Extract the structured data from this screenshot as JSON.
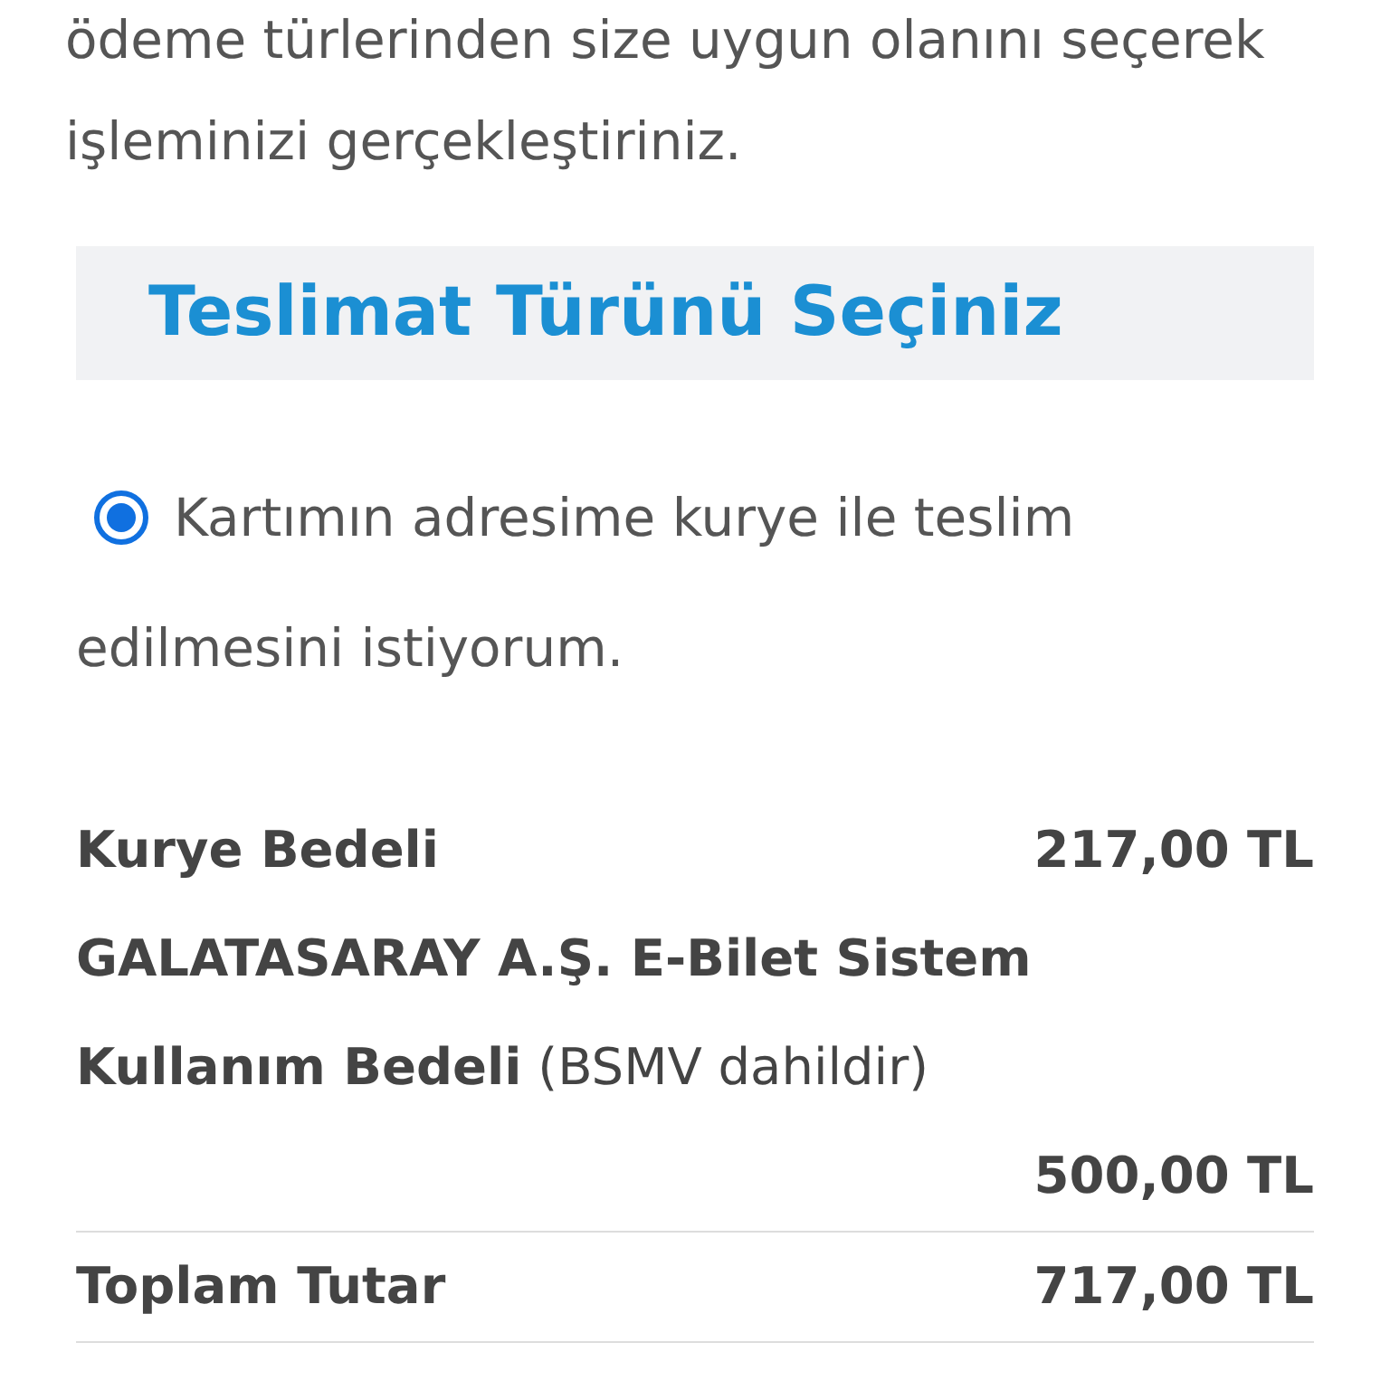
{
  "intro": "ödeme türlerinden size uygun olanını seçerek işleminizi gerçekleştiriniz.",
  "section_title": "Teslimat Türünü Seçiniz",
  "delivery_options": [
    {
      "label": "Kartımın adresime kurye ile teslim edilmesini istiyorum.",
      "selected": true
    }
  ],
  "fees": [
    {
      "label": "**Kurye Bedeli**",
      "amount": "217,00 TL"
    },
    {
      "label": "**GALATASARAY A.Ş. E-Bilet Sistem Kullanım Bedeli** (BSMV dahildir)",
      "amount": "500,00 TL"
    }
  ],
  "total": {
    "label": "Toplam Tutar",
    "amount": "717,00 TL"
  }
}
